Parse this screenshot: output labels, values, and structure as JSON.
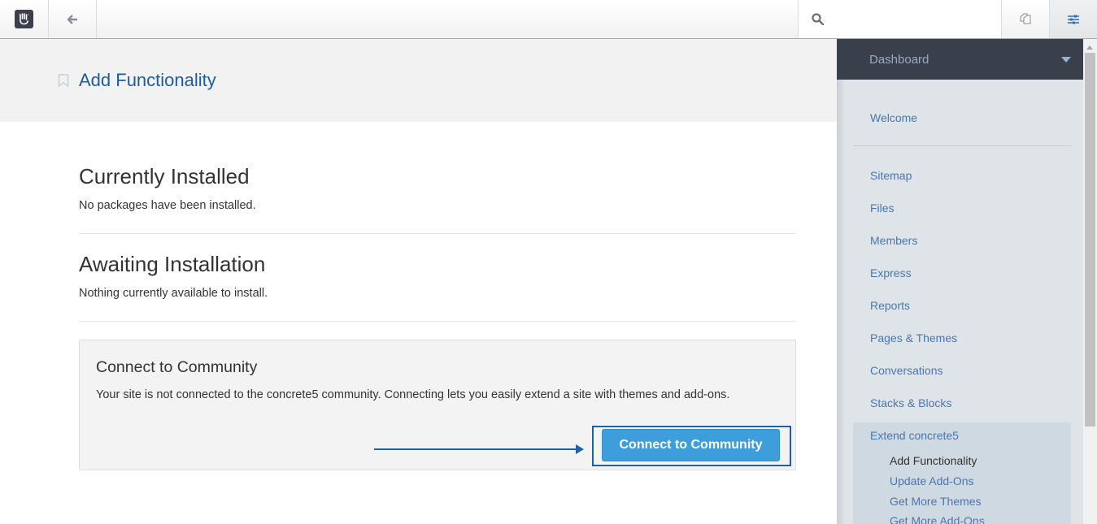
{
  "toolbar": {
    "logo_icon": "concrete5-hand-logo",
    "back_icon": "arrow-left-icon",
    "search_icon": "search-icon",
    "search_placeholder": "",
    "copy_icon": "copy-pages-icon",
    "settings_icon": "sliders-icon"
  },
  "header": {
    "bookmark_icon": "bookmark-icon",
    "title": "Add Functionality"
  },
  "main": {
    "installed": {
      "heading": "Currently Installed",
      "text": "No packages have been installed."
    },
    "awaiting": {
      "heading": "Awaiting Installation",
      "text": "Nothing currently available to install."
    },
    "community": {
      "heading": "Connect to Community",
      "text": "Your site is not connected to the concrete5 community. Connecting lets you easily extend a site with themes and add-ons.",
      "button_label": "Connect to Community"
    }
  },
  "panel": {
    "header_label": "Dashboard",
    "welcome": "Welcome",
    "items": [
      "Sitemap",
      "Files",
      "Members",
      "Express",
      "Reports",
      "Pages & Themes",
      "Conversations",
      "Stacks & Blocks",
      "Extend concrete5"
    ],
    "sub_items": [
      {
        "label": "Add Functionality",
        "active": true
      },
      {
        "label": "Update Add-Ons",
        "active": false
      },
      {
        "label": "Get More Themes",
        "active": false
      },
      {
        "label": "Get More Add-Ons",
        "active": false
      }
    ]
  },
  "colors": {
    "accent": "#1f5c99",
    "button": "#3e9ddb",
    "panel_header": "#3a3f4c",
    "link": "#4a77ad"
  }
}
